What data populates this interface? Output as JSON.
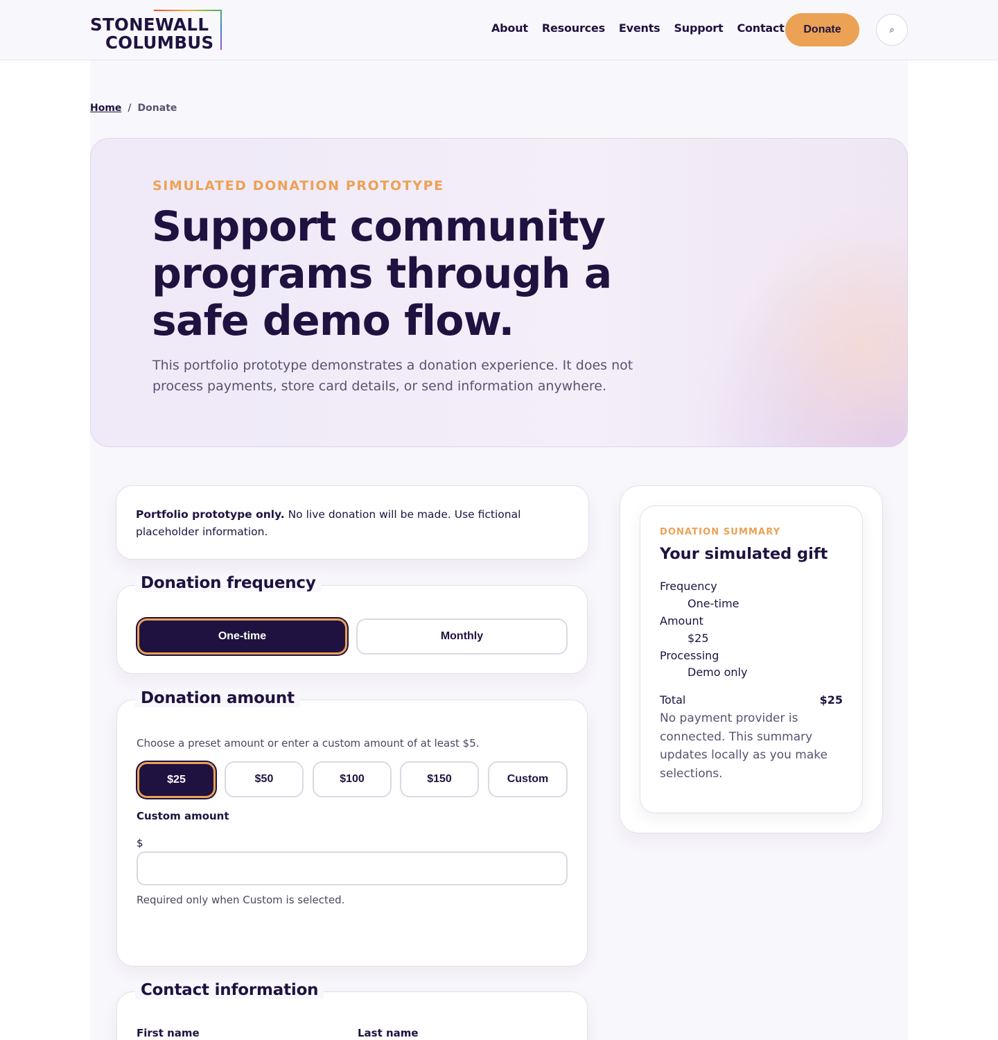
{
  "header": {
    "logo_line1": "STONEWALL",
    "logo_line2": "COLUMBUS",
    "nav": [
      "About",
      "Resources",
      "Events",
      "Support",
      "Contact"
    ],
    "donate_label": "Donate",
    "search_icon": "⌕"
  },
  "breadcrumb": {
    "home": "Home",
    "separator": "/",
    "current": "Donate"
  },
  "hero": {
    "eyebrow": "SIMULATED DONATION PROTOTYPE",
    "title": "Support community programs through a safe demo flow.",
    "subtitle": "This portfolio prototype demonstrates a donation experience. It does not process payments, store card details, or send information anywhere."
  },
  "notice": {
    "bold": "Portfolio prototype only.",
    "text": " No live donation will be made. Use fictional placeholder information."
  },
  "frequency": {
    "legend": "Donation frequency",
    "options": [
      "One-time",
      "Monthly"
    ],
    "selected": "One-time"
  },
  "amount": {
    "legend": "Donation amount",
    "hint": "Choose a preset amount or enter a custom amount of at least $5.",
    "options": [
      "$25",
      "$50",
      "$100",
      "$150",
      "Custom"
    ],
    "selected": "$25",
    "custom_label": "Custom amount",
    "currency_symbol": "$",
    "custom_value": "",
    "custom_hint": "Required only when Custom is selected."
  },
  "contact": {
    "legend": "Contact information",
    "first_name_label": "First name",
    "last_name_label": "Last name"
  },
  "summary": {
    "eyebrow": "DONATION SUMMARY",
    "title": "Your simulated gift",
    "frequency_label": "Frequency",
    "frequency_value": "One-time",
    "amount_label": "Amount",
    "amount_value": "$25",
    "processing_label": "Processing",
    "processing_value": "Demo only",
    "total_label": "Total",
    "total_value": "$25",
    "note": "No payment provider is connected. This summary updates locally as you make selections."
  },
  "colors": {
    "brand_dark": "#1f1240",
    "accent_orange": "#eba255",
    "muted_text": "#5a5270"
  }
}
